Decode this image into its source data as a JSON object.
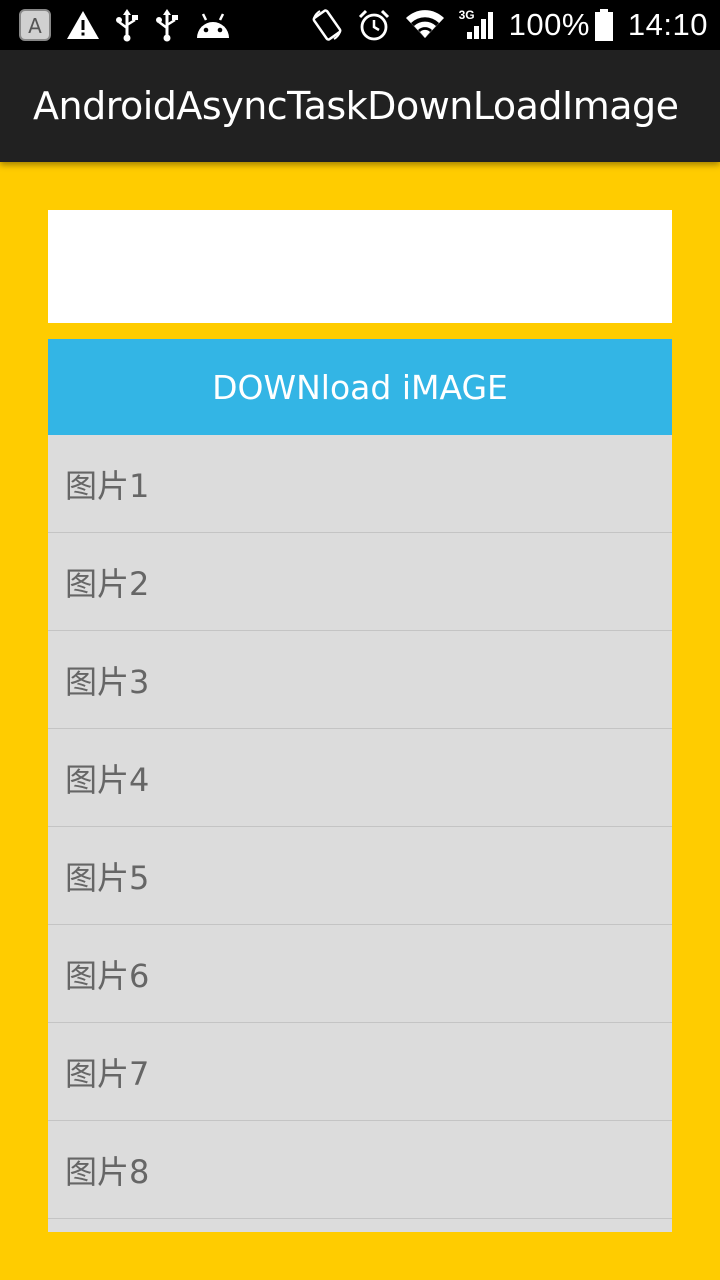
{
  "status_bar": {
    "network_type": "3G",
    "battery": "100%",
    "time": "14:10",
    "icons": [
      "keyboard-a-icon",
      "warning-icon",
      "usb-icon",
      "usb-icon",
      "android-icon",
      "screen-rotation-icon",
      "alarm-icon",
      "wifi-icon",
      "cell-signal-icon",
      "battery-icon"
    ]
  },
  "action_bar": {
    "title": "AndroidAsyncTaskDownLoadImage"
  },
  "main": {
    "download_button_label": "DOWNload iMAGE",
    "list_items": [
      {
        "label": "图片1"
      },
      {
        "label": "图片2"
      },
      {
        "label": "图片3"
      },
      {
        "label": "图片4"
      },
      {
        "label": "图片5"
      },
      {
        "label": "图片6"
      },
      {
        "label": "图片7"
      },
      {
        "label": "图片8"
      }
    ]
  },
  "colors": {
    "background": "#FFCC00",
    "action_bar": "#212121",
    "button": "#33B5E5",
    "list_background": "#DCDCDC",
    "list_text": "#666666"
  }
}
